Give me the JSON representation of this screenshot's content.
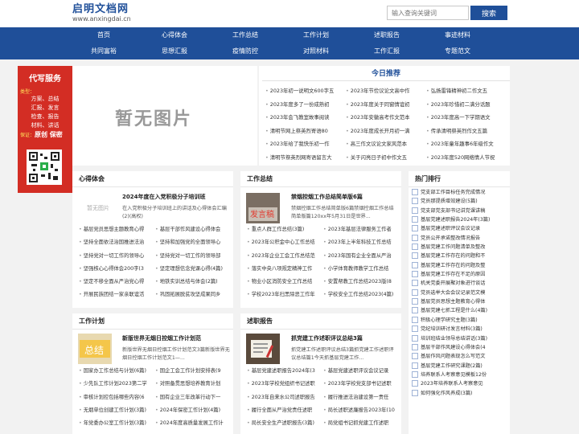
{
  "site": {
    "name": "启明文档网",
    "domain": "www.anxingdai.cn"
  },
  "search": {
    "placeholder": "输入查询关键词",
    "button": "搜索"
  },
  "nav": {
    "row1": [
      "首页",
      "心得体会",
      "工作总结",
      "工作计划",
      "述职报告",
      "事迹材料"
    ],
    "row2": [
      "共同富裕",
      "思想汇报",
      "疫情防控",
      "对照材料",
      "工作汇报",
      "专题范文"
    ]
  },
  "ad": {
    "title": "代写服务",
    "label": "类型：",
    "items": [
      "方案、总结",
      "汇报、发言",
      "检查、报告",
      "材料、讲话"
    ],
    "footer_label": "保证：",
    "footer": "原创 保密"
  },
  "placeholder_text": "暂无图片",
  "recommend": {
    "title": "今日推荐",
    "items": [
      "2023年初一说明文600字五",
      "2023年节俭议论文高中作",
      "弘扬雷锋精神初二作文五",
      "2023年度多了一份成熟初",
      "2023年度关于同窗情谊初",
      "2023年珍惜初二满分话题",
      "2023年会飞教室故事阅读",
      "2023年安徽高考作文范本",
      "2023年度高一下学期语文",
      "清明节网上祭英烈寄语80",
      "2023年度成长开月初一满",
      "传承清明祭英烈作文五篇",
      "2023年给了我快乐初一作",
      "高三作文议论文家风范本",
      "2023年童年趣事6年级作文",
      "清明节祭英烈网寄语留言大",
      "关于闪亮日子初中作文五",
      "2023年度520网络情人节祝"
    ]
  },
  "xinde": {
    "title": "心得体会",
    "feat_title": "2024年度在入党积极分子培训班",
    "feat_text": "在入党积极分子培训班上的讲话及心得体会汇编(2)(高权)",
    "thumb": "暂无图片",
    "items": [
      "基层党员思想主题教育心得",
      "基层干部作风建设心得体会",
      "坚持全面依法治国推进法治",
      "坚持和加强党的全面领导心",
      "坚持党对一切工作的领导心",
      "坚持党对一切工作的领导部",
      "坚强核心心得体会200字(3",
      "坚定理想信念党课心得(4篇)",
      "坚定不移全面从严治党心得",
      "地铁实训总结与体会(2篇)",
      "开展民族团结一家亲联谊活",
      "巩固拓展脱贫攻坚成果同乡"
    ]
  },
  "zongjie": {
    "title": "工作总结",
    "feat_title": "禁烟控烟工作总结简单版6篇",
    "feat_text": "禁烟控烟工作总结简单版6篇禁烟控烟工作总结简单版篇120xx年5月31日是世界...",
    "items": [
      "重点人群工作总结(3篇)",
      "2023年基层法律服务工作者",
      "2023年公积金中心工作总结",
      "2023年上半年科技工作总结",
      "2023年企业工会工作总结范",
      "2023年国有企业全面从严治",
      "落实中央八项规定精神工作",
      "小学体育教师教学工作总结",
      "物业小区消防安全工作总结",
      "安置帮教工作总结2023版(8",
      "学校2023年扫黑除恶工作年",
      "学校安全工作总结2023(4篇)"
    ]
  },
  "hot": {
    "title": "热门排行",
    "items": [
      "党支部工作目标任务完成情况",
      "党员那提质增效建设(5篇)",
      "党支部党支部书记讲党课讲稿",
      "基层党建述职报告2024年(3篇)",
      "基层党建述职评议会议记录",
      "党员公开承诺整改情况报告",
      "基层党建工作问题清单及整改",
      "基层党建工作存在的问题和不",
      "基层党建工作存在的问题及整",
      "基层党建工作存在不足的原因",
      "机关党委开展聚对象进行谈话",
      "党员选举大会会议记录范文模",
      "基层党员思想主题教育心得体",
      "基层党建七抓工程是什么(4篇)",
      "积极心理学研究主题(3篇)",
      "党纪培训研讨发言材料(3篇)",
      "培训班结业领导总结讲话(3篇)",
      "基层干部作风建设心得体会(4",
      "基层作风问题表现怎么写范文",
      "基层党建工作研究课题(2篇)",
      "培养联系人考察意见模板12份",
      "2023年培养联系人考察意见",
      "如何强化作风养成(3篇)"
    ]
  },
  "jihua": {
    "title": "工作计划",
    "feat_title": "新版世界无烟日控烟工作计划范",
    "feat_text": "新版世界无烟日控烟工作计划范文3篇新版世界无烟日控烟工作计划范文1—...",
    "thumb": "总结",
    "items": [
      "国家办工作总结与计划(6篇)",
      "国企工会工作计划安排表(9",
      "少先队工作计划2023第二学",
      "对照备贯思想培养教育计划",
      "审核计划控包括哪些内容(6",
      "国有企业三年改革行动下一",
      "无烟单位创建工作计划(3篇)",
      "2024年保密工作计划(4篇)",
      "年党委办公室工作计划(3篇)",
      "2024年度高质量发展工作计"
    ]
  },
  "shuzhi": {
    "title": "述职报告",
    "feat_title": "抓党建工作述职评议总结3篇",
    "feat_text": "抓党建工作述职评议总结3篇抓党建工作述职评议总结篇1今天抓基层党建工作...",
    "items": [
      "基层党建述职报告2024年(3",
      "基层党建述职评议会议记录",
      "2023年学校党组织书记述职",
      "2023年学校党支部书记述职",
      "2023年自来水公司述职报告",
      "履行推进法治建设第一责任",
      "履行全面从严治党责任述职",
      "局长述职述廉报告2023年(10",
      "局长安全生产述职报告(3篇)",
      "局党组书记抓党建工作述职"
    ]
  }
}
